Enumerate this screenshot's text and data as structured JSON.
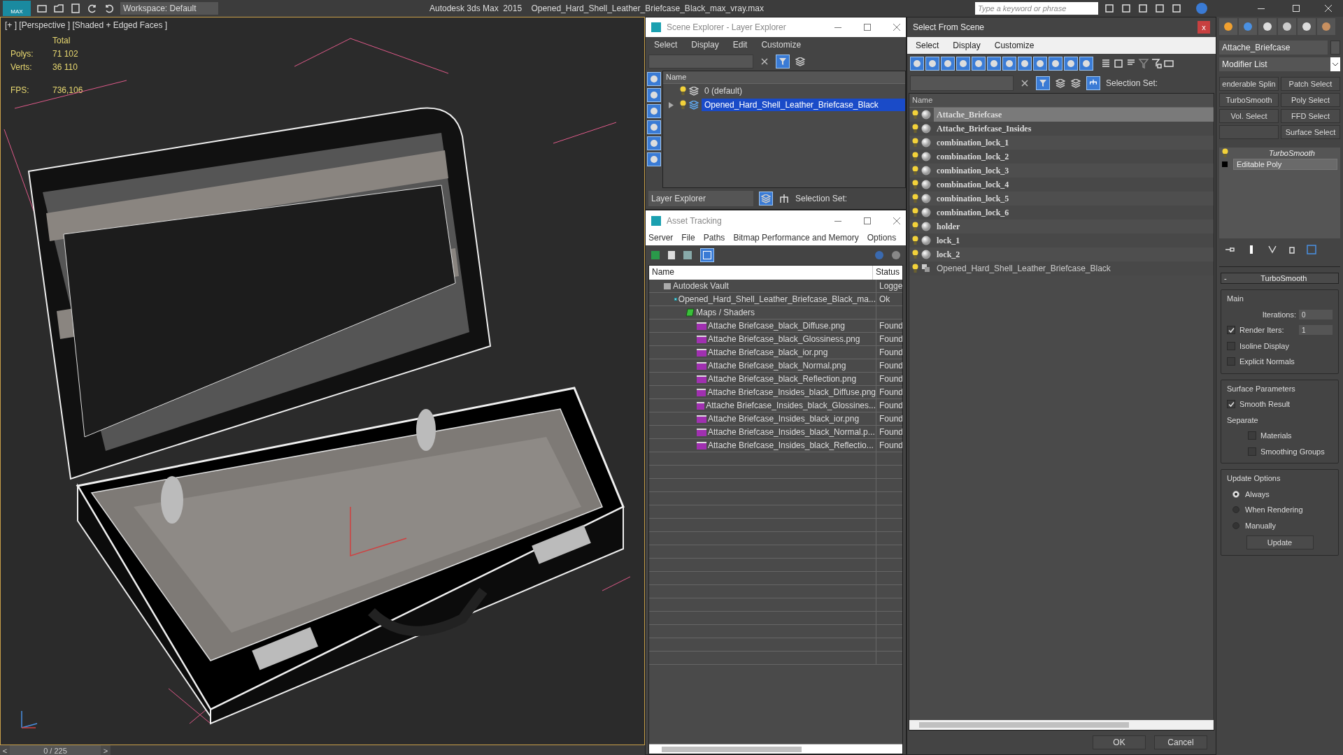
{
  "app": {
    "logo": "MAX",
    "workspace": "Workspace: Default",
    "title": "Autodesk 3ds Max  2015    Opened_Hard_Shell_Leather_Briefcase_Black_max_vray.max",
    "search": {
      "placeholder": "Type a keyword or phrase"
    }
  },
  "viewport": {
    "label": "[+ ] [Perspective ] [Shaded + Edged Faces ]",
    "stats_header": "Total",
    "stats": [
      {
        "label": "Polys:",
        "value": "71 102"
      },
      {
        "label": "Verts:",
        "value": "36 110"
      }
    ],
    "fps": {
      "label": "FPS:",
      "value": "736,106"
    }
  },
  "timeline": {
    "prev": "<",
    "position": "0 / 225",
    "level": 0,
    "next": ">"
  },
  "scene_explorer": {
    "title": "Scene Explorer - Layer Explorer",
    "menu": [
      "Select",
      "Display",
      "Edit",
      "Customize"
    ],
    "column": "Name",
    "layers": [
      {
        "name": "0 (default)",
        "has_children": false,
        "selected": false
      },
      {
        "name": "Opened_Hard_Shell_Leather_Briefcase_Black",
        "has_children": true,
        "selected": true
      }
    ],
    "mode": "Layer Explorer",
    "selection_set": "Selection Set:"
  },
  "asset_tracking": {
    "title": "Asset Tracking",
    "menu": [
      "Server",
      "File",
      "Paths",
      "Bitmap Performance and Memory",
      "Options"
    ],
    "columns": [
      "Name",
      "Status"
    ],
    "tree": [
      {
        "name": "Autodesk Vault",
        "status": "Logge",
        "kind": "vault",
        "children": [
          {
            "name": "Opened_Hard_Shell_Leather_Briefcase_Black_ma...",
            "status": "Ok",
            "kind": "scene",
            "children": [
              {
                "name": "Maps / Shaders",
                "kind": "maps",
                "children": [
                  {
                    "name": "Attache Briefcase_black_Diffuse.png",
                    "status": "Found",
                    "kind": "png"
                  },
                  {
                    "name": "Attache Briefcase_black_Glossiness.png",
                    "status": "Found",
                    "kind": "png"
                  },
                  {
                    "name": "Attache Briefcase_black_ior.png",
                    "status": "Found",
                    "kind": "png"
                  },
                  {
                    "name": "Attache Briefcase_black_Normal.png",
                    "status": "Found",
                    "kind": "png"
                  },
                  {
                    "name": "Attache Briefcase_black_Reflection.png",
                    "status": "Found",
                    "kind": "png"
                  },
                  {
                    "name": "Attache Briefcase_Insides_black_Diffuse.png",
                    "status": "Found",
                    "kind": "png"
                  },
                  {
                    "name": "Attache Briefcase_Insides_black_Glossines...",
                    "status": "Found",
                    "kind": "png"
                  },
                  {
                    "name": "Attache Briefcase_Insides_black_ior.png",
                    "status": "Found",
                    "kind": "png"
                  },
                  {
                    "name": "Attache Briefcase_Insides_black_Normal.p...",
                    "status": "Found",
                    "kind": "png"
                  },
                  {
                    "name": "Attache Briefcase_Insides_black_Reflectio...",
                    "status": "Found",
                    "kind": "png"
                  }
                ]
              }
            ]
          }
        ]
      }
    ]
  },
  "select_from_scene": {
    "title": "Select From Scene",
    "close": "x",
    "menu": [
      "Select",
      "Display",
      "Customize"
    ],
    "selection_set": "Selection Set:",
    "column": "Name",
    "objects": [
      {
        "name": "Attache_Briefcase",
        "kind": "geometry",
        "selected": true
      },
      {
        "name": "Attache_Briefcase_Insides",
        "kind": "geometry",
        "selected": false
      },
      {
        "name": "combination_lock_1",
        "kind": "geometry",
        "selected": false
      },
      {
        "name": "combination_lock_2",
        "kind": "geometry",
        "selected": false
      },
      {
        "name": "combination_lock_3",
        "kind": "geometry",
        "selected": false
      },
      {
        "name": "combination_lock_4",
        "kind": "geometry",
        "selected": false
      },
      {
        "name": "combination_lock_5",
        "kind": "geometry",
        "selected": false
      },
      {
        "name": "combination_lock_6",
        "kind": "geometry",
        "selected": false
      },
      {
        "name": "holder",
        "kind": "geometry",
        "selected": false
      },
      {
        "name": "lock_1",
        "kind": "geometry",
        "selected": false
      },
      {
        "name": "lock_2",
        "kind": "geometry",
        "selected": false
      },
      {
        "name": "Opened_Hard_Shell_Leather_Briefcase_Black",
        "kind": "group",
        "selected": false
      }
    ],
    "ok": "OK",
    "cancel": "Cancel"
  },
  "command_panel": {
    "object_name": "Attache_Briefcase",
    "modifier_list": "Modifier List",
    "modifier_buttons": [
      "enderable Splin",
      "Patch Select",
      "TurboSmooth",
      "Poly Select",
      "Vol. Select",
      "FFD Select",
      "Surface Select"
    ],
    "stack": [
      {
        "name": "TurboSmooth",
        "kind": "modifier",
        "selected": false
      },
      {
        "name": "Editable Poly",
        "kind": "base",
        "selected": true
      }
    ],
    "rollout": {
      "title": "TurboSmooth",
      "collapse": "-",
      "main": {
        "title": "Main",
        "iterations_label": "Iterations:",
        "iterations": "0",
        "render_iters": {
          "label": "Render Iters:",
          "checked": true,
          "value": "1"
        },
        "isoline": {
          "label": "Isoline Display",
          "checked": false
        },
        "explicit_normals": {
          "label": "Explicit Normals",
          "checked": false
        }
      },
      "surface": {
        "title": "Surface Parameters",
        "smooth_result": {
          "label": "Smooth Result",
          "checked": true
        },
        "separate": "Separate",
        "materials": {
          "label": "Materials",
          "checked": false
        },
        "smoothing_groups": {
          "label": "Smoothing Groups",
          "checked": false
        }
      },
      "update": {
        "title": "Update Options",
        "options": [
          {
            "label": "Always",
            "selected": true
          },
          {
            "label": "When Rendering",
            "selected": false
          },
          {
            "label": "Manually",
            "selected": false
          }
        ],
        "button": "Update"
      }
    }
  }
}
